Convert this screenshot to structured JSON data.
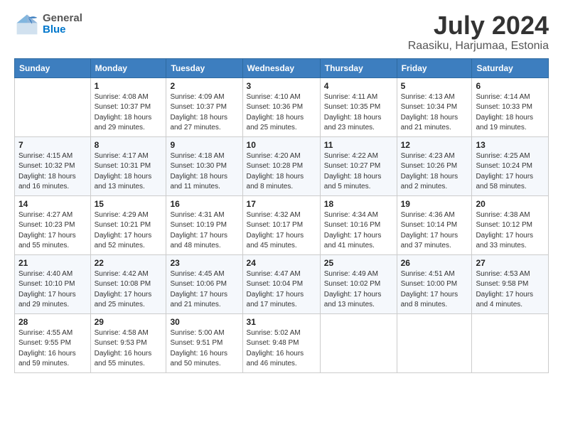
{
  "logo": {
    "name_top": "General",
    "name_bottom": "Blue"
  },
  "title": "July 2024",
  "subtitle": "Raasiku, Harjumaa, Estonia",
  "days_header": [
    "Sunday",
    "Monday",
    "Tuesday",
    "Wednesday",
    "Thursday",
    "Friday",
    "Saturday"
  ],
  "weeks": [
    [
      {
        "num": "",
        "sunrise": "",
        "sunset": "",
        "daylight": ""
      },
      {
        "num": "1",
        "sunrise": "Sunrise: 4:08 AM",
        "sunset": "Sunset: 10:37 PM",
        "daylight": "Daylight: 18 hours and 29 minutes."
      },
      {
        "num": "2",
        "sunrise": "Sunrise: 4:09 AM",
        "sunset": "Sunset: 10:37 PM",
        "daylight": "Daylight: 18 hours and 27 minutes."
      },
      {
        "num": "3",
        "sunrise": "Sunrise: 4:10 AM",
        "sunset": "Sunset: 10:36 PM",
        "daylight": "Daylight: 18 hours and 25 minutes."
      },
      {
        "num": "4",
        "sunrise": "Sunrise: 4:11 AM",
        "sunset": "Sunset: 10:35 PM",
        "daylight": "Daylight: 18 hours and 23 minutes."
      },
      {
        "num": "5",
        "sunrise": "Sunrise: 4:13 AM",
        "sunset": "Sunset: 10:34 PM",
        "daylight": "Daylight: 18 hours and 21 minutes."
      },
      {
        "num": "6",
        "sunrise": "Sunrise: 4:14 AM",
        "sunset": "Sunset: 10:33 PM",
        "daylight": "Daylight: 18 hours and 19 minutes."
      }
    ],
    [
      {
        "num": "7",
        "sunrise": "Sunrise: 4:15 AM",
        "sunset": "Sunset: 10:32 PM",
        "daylight": "Daylight: 18 hours and 16 minutes."
      },
      {
        "num": "8",
        "sunrise": "Sunrise: 4:17 AM",
        "sunset": "Sunset: 10:31 PM",
        "daylight": "Daylight: 18 hours and 13 minutes."
      },
      {
        "num": "9",
        "sunrise": "Sunrise: 4:18 AM",
        "sunset": "Sunset: 10:30 PM",
        "daylight": "Daylight: 18 hours and 11 minutes."
      },
      {
        "num": "10",
        "sunrise": "Sunrise: 4:20 AM",
        "sunset": "Sunset: 10:28 PM",
        "daylight": "Daylight: 18 hours and 8 minutes."
      },
      {
        "num": "11",
        "sunrise": "Sunrise: 4:22 AM",
        "sunset": "Sunset: 10:27 PM",
        "daylight": "Daylight: 18 hours and 5 minutes."
      },
      {
        "num": "12",
        "sunrise": "Sunrise: 4:23 AM",
        "sunset": "Sunset: 10:26 PM",
        "daylight": "Daylight: 18 hours and 2 minutes."
      },
      {
        "num": "13",
        "sunrise": "Sunrise: 4:25 AM",
        "sunset": "Sunset: 10:24 PM",
        "daylight": "Daylight: 17 hours and 58 minutes."
      }
    ],
    [
      {
        "num": "14",
        "sunrise": "Sunrise: 4:27 AM",
        "sunset": "Sunset: 10:23 PM",
        "daylight": "Daylight: 17 hours and 55 minutes."
      },
      {
        "num": "15",
        "sunrise": "Sunrise: 4:29 AM",
        "sunset": "Sunset: 10:21 PM",
        "daylight": "Daylight: 17 hours and 52 minutes."
      },
      {
        "num": "16",
        "sunrise": "Sunrise: 4:31 AM",
        "sunset": "Sunset: 10:19 PM",
        "daylight": "Daylight: 17 hours and 48 minutes."
      },
      {
        "num": "17",
        "sunrise": "Sunrise: 4:32 AM",
        "sunset": "Sunset: 10:17 PM",
        "daylight": "Daylight: 17 hours and 45 minutes."
      },
      {
        "num": "18",
        "sunrise": "Sunrise: 4:34 AM",
        "sunset": "Sunset: 10:16 PM",
        "daylight": "Daylight: 17 hours and 41 minutes."
      },
      {
        "num": "19",
        "sunrise": "Sunrise: 4:36 AM",
        "sunset": "Sunset: 10:14 PM",
        "daylight": "Daylight: 17 hours and 37 minutes."
      },
      {
        "num": "20",
        "sunrise": "Sunrise: 4:38 AM",
        "sunset": "Sunset: 10:12 PM",
        "daylight": "Daylight: 17 hours and 33 minutes."
      }
    ],
    [
      {
        "num": "21",
        "sunrise": "Sunrise: 4:40 AM",
        "sunset": "Sunset: 10:10 PM",
        "daylight": "Daylight: 17 hours and 29 minutes."
      },
      {
        "num": "22",
        "sunrise": "Sunrise: 4:42 AM",
        "sunset": "Sunset: 10:08 PM",
        "daylight": "Daylight: 17 hours and 25 minutes."
      },
      {
        "num": "23",
        "sunrise": "Sunrise: 4:45 AM",
        "sunset": "Sunset: 10:06 PM",
        "daylight": "Daylight: 17 hours and 21 minutes."
      },
      {
        "num": "24",
        "sunrise": "Sunrise: 4:47 AM",
        "sunset": "Sunset: 10:04 PM",
        "daylight": "Daylight: 17 hours and 17 minutes."
      },
      {
        "num": "25",
        "sunrise": "Sunrise: 4:49 AM",
        "sunset": "Sunset: 10:02 PM",
        "daylight": "Daylight: 17 hours and 13 minutes."
      },
      {
        "num": "26",
        "sunrise": "Sunrise: 4:51 AM",
        "sunset": "Sunset: 10:00 PM",
        "daylight": "Daylight: 17 hours and 8 minutes."
      },
      {
        "num": "27",
        "sunrise": "Sunrise: 4:53 AM",
        "sunset": "Sunset: 9:58 PM",
        "daylight": "Daylight: 17 hours and 4 minutes."
      }
    ],
    [
      {
        "num": "28",
        "sunrise": "Sunrise: 4:55 AM",
        "sunset": "Sunset: 9:55 PM",
        "daylight": "Daylight: 16 hours and 59 minutes."
      },
      {
        "num": "29",
        "sunrise": "Sunrise: 4:58 AM",
        "sunset": "Sunset: 9:53 PM",
        "daylight": "Daylight: 16 hours and 55 minutes."
      },
      {
        "num": "30",
        "sunrise": "Sunrise: 5:00 AM",
        "sunset": "Sunset: 9:51 PM",
        "daylight": "Daylight: 16 hours and 50 minutes."
      },
      {
        "num": "31",
        "sunrise": "Sunrise: 5:02 AM",
        "sunset": "Sunset: 9:48 PM",
        "daylight": "Daylight: 16 hours and 46 minutes."
      },
      {
        "num": "",
        "sunrise": "",
        "sunset": "",
        "daylight": ""
      },
      {
        "num": "",
        "sunrise": "",
        "sunset": "",
        "daylight": ""
      },
      {
        "num": "",
        "sunrise": "",
        "sunset": "",
        "daylight": ""
      }
    ]
  ]
}
